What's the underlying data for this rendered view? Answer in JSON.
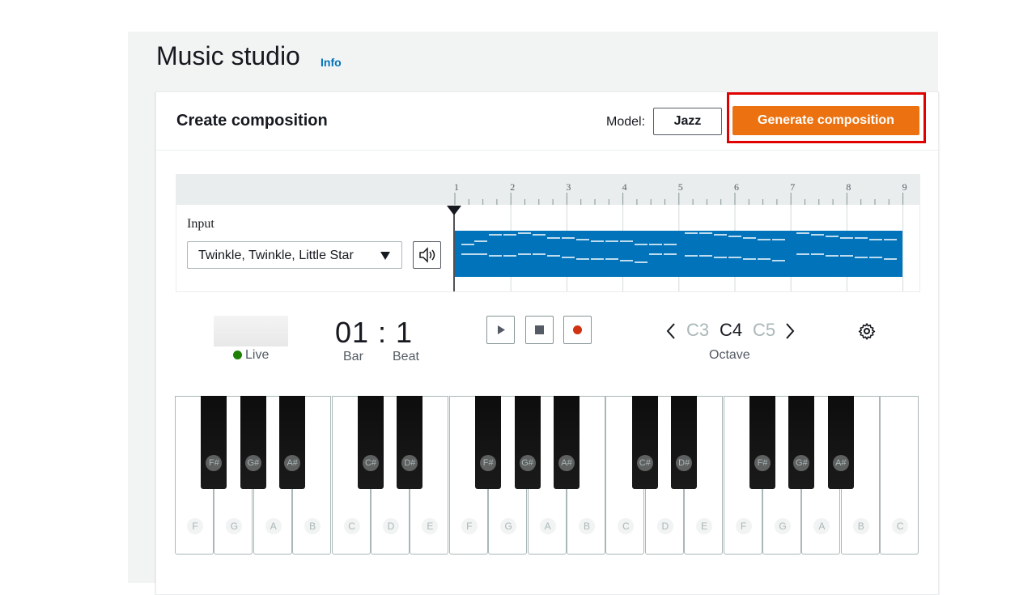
{
  "header": {
    "title": "Music studio",
    "info_link": "Info"
  },
  "card": {
    "title": "Create composition",
    "model_label": "Model:",
    "model_value": "Jazz",
    "generate_label": "Generate composition"
  },
  "timeline": {
    "ruler_numbers": [
      "1",
      "2",
      "3",
      "4",
      "5",
      "6",
      "7",
      "8",
      "9"
    ],
    "input_label": "Input",
    "input_value": "Twinkle, Twinkle, Little Star"
  },
  "transport": {
    "live_label": "Live",
    "time": "01 : 1",
    "bar_label": "Bar",
    "beat_label": "Beat",
    "octaves": [
      "C3",
      "C4",
      "C5"
    ],
    "active_octave": "C4",
    "octave_label": "Octave"
  },
  "keyboard": {
    "white_keys": [
      "F",
      "G",
      "A",
      "B",
      "C",
      "D",
      "E",
      "F",
      "G",
      "A",
      "B",
      "C",
      "D",
      "E",
      "F",
      "G",
      "A",
      "B",
      "C"
    ],
    "black_keys": [
      "F#",
      "G#",
      "A#",
      "C#",
      "D#",
      "F#",
      "G#",
      "A#",
      "C#",
      "D#",
      "F#",
      "G#",
      "A#"
    ]
  },
  "colors": {
    "accent": "#ec7211",
    "track": "#0073bb",
    "live": "#1d8102",
    "record": "#d13212",
    "highlight": "#e00000"
  },
  "icons": [
    "speaker-icon",
    "play-icon",
    "stop-icon",
    "record-icon",
    "chevron-left-icon",
    "chevron-right-icon",
    "gear-icon"
  ]
}
